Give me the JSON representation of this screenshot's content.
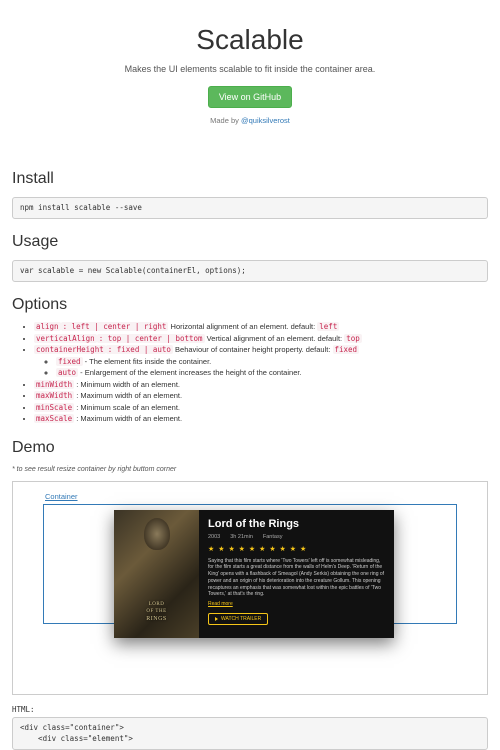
{
  "hero": {
    "title": "Scalable",
    "subtitle": "Makes the UI elements scalable to fit inside the container area.",
    "github_btn": "View on GitHub",
    "madeby_prefix": "Made by ",
    "madeby_handle": "@quiksilverost"
  },
  "sections": {
    "install": "Install",
    "usage": "Usage",
    "options": "Options",
    "demo": "Demo"
  },
  "install_cmd": "npm install scalable --save",
  "usage_code": "var scalable = new Scalable(containerEl, options);",
  "options": [
    {
      "name": "align",
      "vals": ": left | center | right",
      "desc": " Horizontal alignment of an element. default: ",
      "def": "left"
    },
    {
      "name": "verticalAlign",
      "vals": ": top | center | bottom",
      "desc": " Vertical alignment of an element. default: ",
      "def": "top"
    },
    {
      "name": "containerHeight",
      "vals": ": fixed | auto",
      "desc": " Behaviour of container height property. default: ",
      "def": "fixed",
      "sub": [
        {
          "name": "fixed",
          "desc": " - The element fits inside the container."
        },
        {
          "name": "auto",
          "desc": " - Enlargement of the element increases the height of the container."
        }
      ]
    },
    {
      "name": "minWidth",
      "vals": "",
      "desc": " : Minimum width of an element."
    },
    {
      "name": "maxWidth",
      "vals": "",
      "desc": " : Maximum width of an element."
    },
    {
      "name": "minScale",
      "vals": "",
      "desc": " : Minimum scale of an element."
    },
    {
      "name": "maxScale",
      "vals": "",
      "desc": " : Maximum width of an element."
    }
  ],
  "demo": {
    "note": "* to see result resize container by right buttom corner",
    "container_label": "Container",
    "movie": {
      "title": "Lord of the Rings",
      "year": "2003",
      "runtime": "3h 21min",
      "genre": "Fantasy",
      "stars": "★ ★ ★ ★ ★ ★ ★ ★ ★ ★",
      "desc": "Saying that this film starts where 'Two Towers' left off is somewhat misleading, for the film starts a great distance from the walls of Helm's Deep. 'Return of the King' opens with a flashback of Smeagol (Andy Serkis) obtaining the one ring of power and an origin of his deterioration into the creature Gollum. This opening recaptures an emphasis that was somewhat lost within the epic battles of 'Two Towers,' at that's the ring.",
      "readmore": "Read more",
      "trailer": "WATCH TRAILER",
      "poster_line1": "LORD",
      "poster_line2": "OF THE",
      "poster_line3": "RINGS"
    },
    "html_label": "HTML:",
    "html_code": "<div class=\"container\">\n    <div class=\"element\">"
  }
}
